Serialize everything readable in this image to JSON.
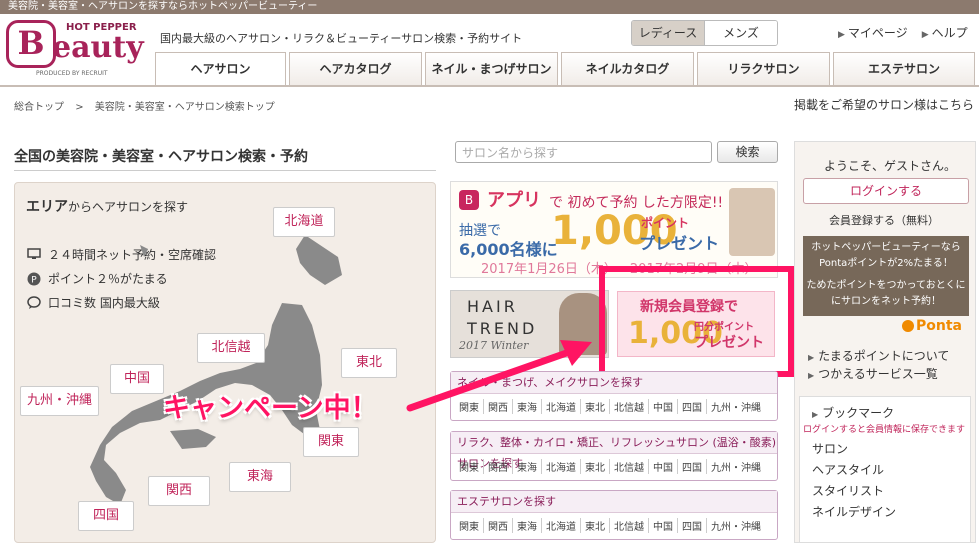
{
  "topbar": {
    "text": "美容院・美容室・ヘアサロンを探すならホットペッパービューティー"
  },
  "logo": {
    "hotpepper": "HOT PEPPER",
    "word": "eauty",
    "initial": "B",
    "produced": "PRODUCED BY RECRUIT"
  },
  "header": {
    "tagline": "国内最大級のヘアサロン・リラク＆ビューティーサロン検索・予約サイト",
    "gender": {
      "ladies": "レディース",
      "mens": "メンズ"
    },
    "mypage": "マイページ",
    "help": "ヘルプ"
  },
  "tabs": [
    {
      "label": "ヘアサロン"
    },
    {
      "label": "ヘアカタログ"
    },
    {
      "label": "ネイル・まつげサロン"
    },
    {
      "label": "ネイルカタログ"
    },
    {
      "label": "リラクサロン"
    },
    {
      "label": "エステサロン"
    }
  ],
  "breadcrumb": {
    "home": "総合トップ",
    "sep": ">",
    "current": "美容院・美容室・ヘアサロン検索トップ"
  },
  "owner_link": "掲載をご希望のサロン様はこちら",
  "page_title": "全国の美容院・美容室・ヘアサロン検索・予約",
  "search": {
    "placeholder": "サロン名から探す",
    "button": "検索"
  },
  "area": {
    "title_bold": "エリア",
    "title_rest": "からヘアサロンを探す",
    "features": [
      "２４時間ネット予約・空席確認",
      "ポイント２％がたまる",
      "口コミ数 国内最大級"
    ],
    "regions": {
      "hokkaido": "北海道",
      "tohoku": "東北",
      "hokushinetsu": "北信越",
      "chugoku": "中国",
      "kyushu": "九州・沖縄",
      "kanto": "関東",
      "tokai": "東海",
      "kansai": "関西",
      "shikoku": "四国"
    }
  },
  "promo_app": {
    "icon": "B",
    "line1a": "アプリ",
    "line1b": "で 初めて予約 した方限定!!",
    "line2": "抽選で",
    "line3": "6,000名様に",
    "big": "1,000",
    "pt": "ポイント",
    "present": "プレゼント",
    "date": "2017年1月26日（木）〜2017年2月9日（木）"
  },
  "hair_trend": {
    "l1": "HAIR",
    "l2": "TREND",
    "l3": "2017 Winter"
  },
  "new_member": {
    "l1": "新規会員登録で",
    "big": "1,000",
    "unit": "円分ポイント",
    "present": "プレゼント"
  },
  "callout": "キャンペーン中！",
  "salon_boxes": [
    {
      "title": "ネイル・まつげ、メイクサロンを探す",
      "regions": [
        "関東",
        "関西",
        "東海",
        "北海道",
        "東北",
        "北信越",
        "中国",
        "四国",
        "九州・沖縄"
      ]
    },
    {
      "title": "リラク、整体・カイロ・矯正、リフレッシュサロン (温浴・酸素) サロンを探す",
      "regions": [
        "関東",
        "関西",
        "東海",
        "北海道",
        "東北",
        "北信越",
        "中国",
        "四国",
        "九州・沖縄"
      ]
    },
    {
      "title": "エステサロンを探す",
      "regions": [
        "関東",
        "関西",
        "東海",
        "北海道",
        "東北",
        "北信越",
        "中国",
        "四国",
        "九州・沖縄"
      ]
    }
  ],
  "sidebar": {
    "welcome": "ようこそ、ゲストさん。",
    "login": "ログインする",
    "register": "会員登録する（無料）",
    "ponta_text1": "ホットペッパービューティーなら",
    "ponta_text2": "Pontaポイントが2%たまる！",
    "ponta_text3": "ためたポイントをつかっておとくに",
    "ponta_text4": "にサロンをネット予約！",
    "ponta_logo": "Ponta",
    "links": [
      "たまるポイントについて",
      "つかえるサービス一覧"
    ],
    "bookmark_title": "ブックマーク",
    "bookmark_note": "ログインすると会員情報に保存できます",
    "bookmarks": [
      "サロン",
      "ヘアスタイル",
      "スタイリスト",
      "ネイルデザイン"
    ]
  },
  "colors": {
    "brand": "#a8235a",
    "accent": "#ff1463",
    "topbar": "#8c7a6e"
  }
}
